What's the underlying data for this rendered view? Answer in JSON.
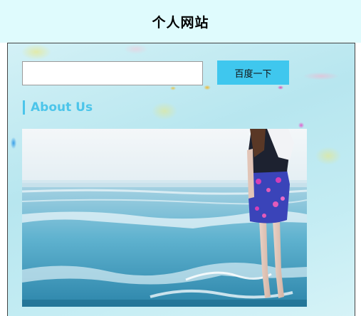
{
  "header": {
    "title": "个人网站"
  },
  "search": {
    "value": "",
    "placeholder": "",
    "button_label": "百度一下"
  },
  "section": {
    "heading": "About Us"
  },
  "photo": {
    "subject": "beach-photo"
  },
  "colors": {
    "header_bg": "#dffbfd",
    "accent": "#3fc7ee",
    "heading": "#4cc5ea"
  }
}
